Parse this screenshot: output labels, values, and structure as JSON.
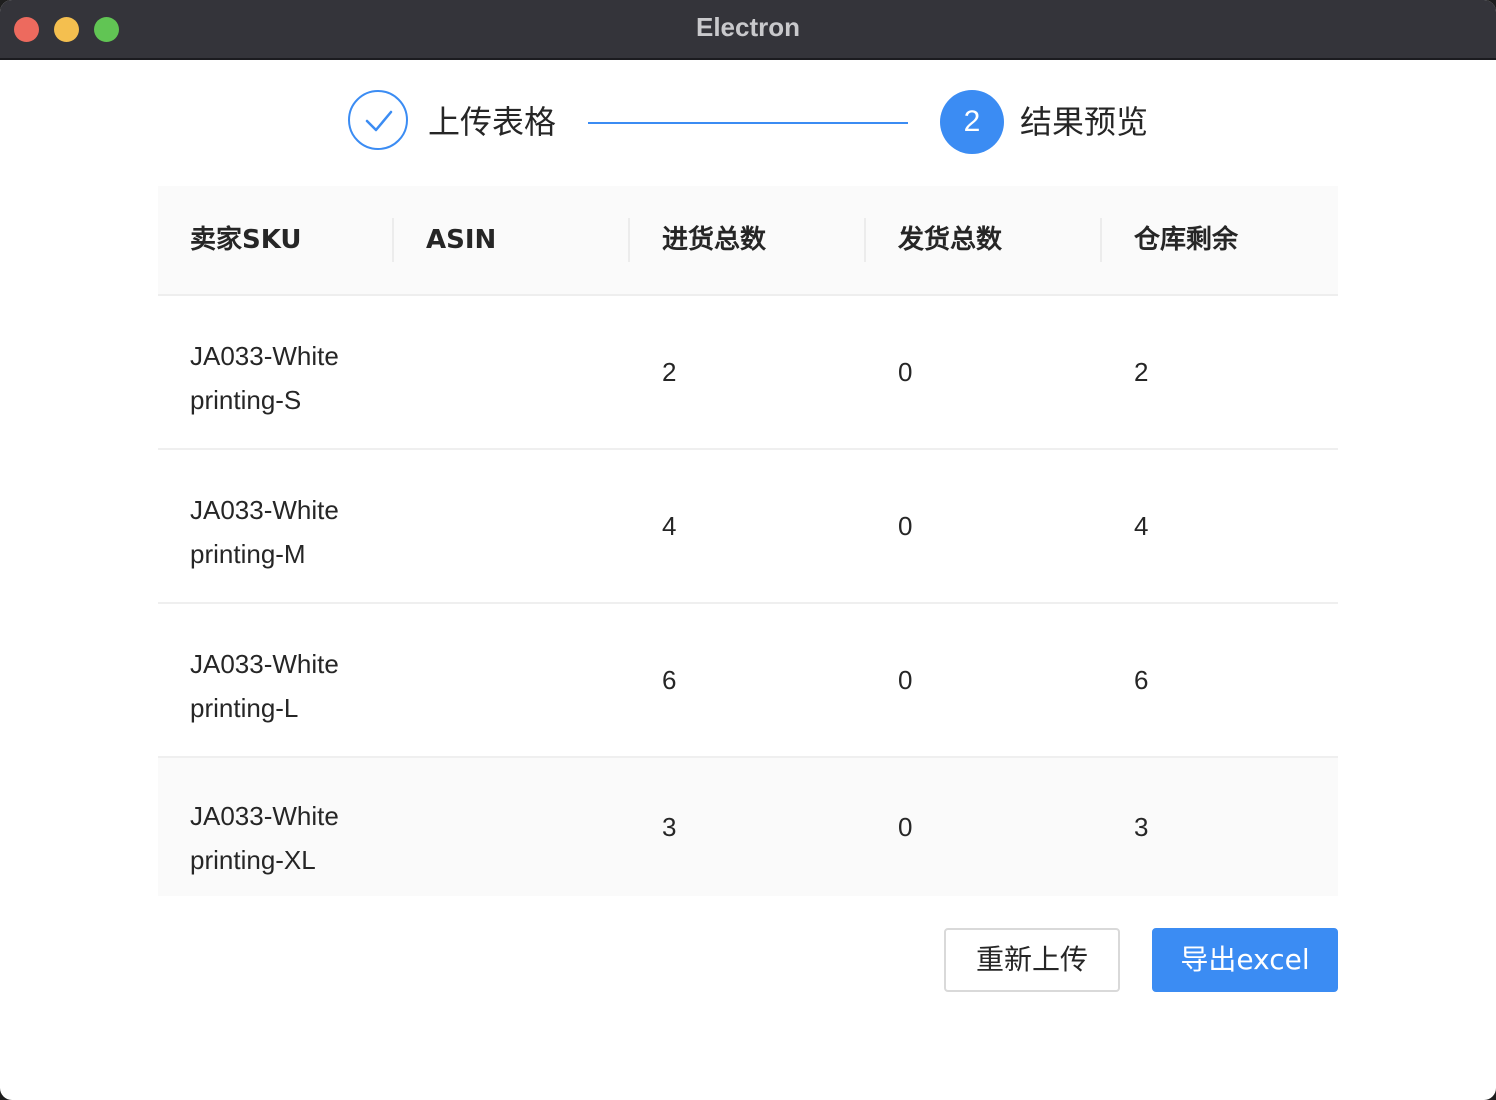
{
  "window": {
    "title": "Electron"
  },
  "steps": [
    {
      "label": "上传表格",
      "status": "done"
    },
    {
      "number": "2",
      "label": "结果预览",
      "status": "active"
    }
  ],
  "table": {
    "columns": [
      "卖家SKU",
      "ASIN",
      "进货总数",
      "发货总数",
      "仓库剩余"
    ],
    "rows": [
      {
        "sku_line1": "JA033-White",
        "sku_line2": "printing-S",
        "asin": "",
        "in_total": "2",
        "out_total": "0",
        "remaining": "2"
      },
      {
        "sku_line1": "JA033-White",
        "sku_line2": "printing-M",
        "asin": "",
        "in_total": "4",
        "out_total": "0",
        "remaining": "4"
      },
      {
        "sku_line1": "JA033-White",
        "sku_line2": "printing-L",
        "asin": "",
        "in_total": "6",
        "out_total": "0",
        "remaining": "6"
      },
      {
        "sku_line1": "JA033-White",
        "sku_line2": "printing-XL",
        "asin": "",
        "in_total": "3",
        "out_total": "0",
        "remaining": "3"
      }
    ]
  },
  "actions": {
    "reupload_label": "重新上传",
    "export_label": "导出excel"
  },
  "colors": {
    "accent": "#3b8cf3",
    "titlebar": "#34343a"
  },
  "icons": {
    "done_step": "check-icon"
  }
}
